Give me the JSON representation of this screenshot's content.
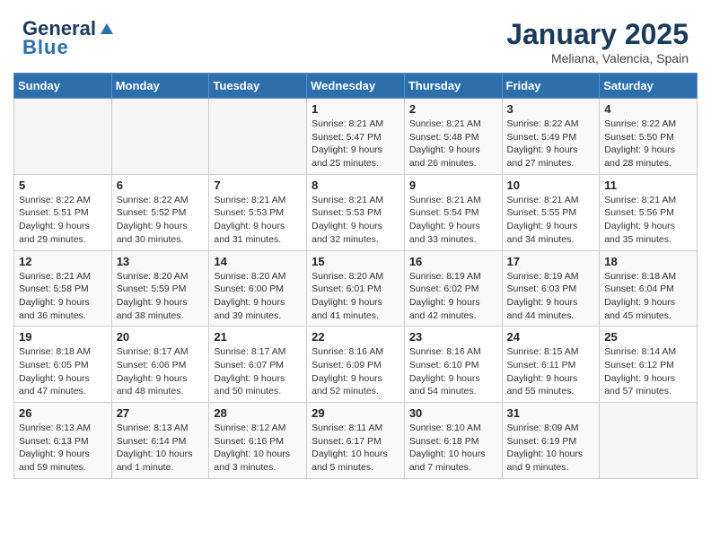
{
  "header": {
    "logo_line1": "General",
    "logo_line2": "Blue",
    "month": "January 2025",
    "location": "Meliana, Valencia, Spain"
  },
  "weekdays": [
    "Sunday",
    "Monday",
    "Tuesday",
    "Wednesday",
    "Thursday",
    "Friday",
    "Saturday"
  ],
  "weeks": [
    [
      {
        "day": "",
        "info": ""
      },
      {
        "day": "",
        "info": ""
      },
      {
        "day": "",
        "info": ""
      },
      {
        "day": "1",
        "info": "Sunrise: 8:21 AM\nSunset: 5:47 PM\nDaylight: 9 hours and 25 minutes."
      },
      {
        "day": "2",
        "info": "Sunrise: 8:21 AM\nSunset: 5:48 PM\nDaylight: 9 hours and 26 minutes."
      },
      {
        "day": "3",
        "info": "Sunrise: 8:22 AM\nSunset: 5:49 PM\nDaylight: 9 hours and 27 minutes."
      },
      {
        "day": "4",
        "info": "Sunrise: 8:22 AM\nSunset: 5:50 PM\nDaylight: 9 hours and 28 minutes."
      }
    ],
    [
      {
        "day": "5",
        "info": "Sunrise: 8:22 AM\nSunset: 5:51 PM\nDaylight: 9 hours and 29 minutes."
      },
      {
        "day": "6",
        "info": "Sunrise: 8:22 AM\nSunset: 5:52 PM\nDaylight: 9 hours and 30 minutes."
      },
      {
        "day": "7",
        "info": "Sunrise: 8:21 AM\nSunset: 5:53 PM\nDaylight: 9 hours and 31 minutes."
      },
      {
        "day": "8",
        "info": "Sunrise: 8:21 AM\nSunset: 5:53 PM\nDaylight: 9 hours and 32 minutes."
      },
      {
        "day": "9",
        "info": "Sunrise: 8:21 AM\nSunset: 5:54 PM\nDaylight: 9 hours and 33 minutes."
      },
      {
        "day": "10",
        "info": "Sunrise: 8:21 AM\nSunset: 5:55 PM\nDaylight: 9 hours and 34 minutes."
      },
      {
        "day": "11",
        "info": "Sunrise: 8:21 AM\nSunset: 5:56 PM\nDaylight: 9 hours and 35 minutes."
      }
    ],
    [
      {
        "day": "12",
        "info": "Sunrise: 8:21 AM\nSunset: 5:58 PM\nDaylight: 9 hours and 36 minutes."
      },
      {
        "day": "13",
        "info": "Sunrise: 8:20 AM\nSunset: 5:59 PM\nDaylight: 9 hours and 38 minutes."
      },
      {
        "day": "14",
        "info": "Sunrise: 8:20 AM\nSunset: 6:00 PM\nDaylight: 9 hours and 39 minutes."
      },
      {
        "day": "15",
        "info": "Sunrise: 8:20 AM\nSunset: 6:01 PM\nDaylight: 9 hours and 41 minutes."
      },
      {
        "day": "16",
        "info": "Sunrise: 8:19 AM\nSunset: 6:02 PM\nDaylight: 9 hours and 42 minutes."
      },
      {
        "day": "17",
        "info": "Sunrise: 8:19 AM\nSunset: 6:03 PM\nDaylight: 9 hours and 44 minutes."
      },
      {
        "day": "18",
        "info": "Sunrise: 8:18 AM\nSunset: 6:04 PM\nDaylight: 9 hours and 45 minutes."
      }
    ],
    [
      {
        "day": "19",
        "info": "Sunrise: 8:18 AM\nSunset: 6:05 PM\nDaylight: 9 hours and 47 minutes."
      },
      {
        "day": "20",
        "info": "Sunrise: 8:17 AM\nSunset: 6:06 PM\nDaylight: 9 hours and 48 minutes."
      },
      {
        "day": "21",
        "info": "Sunrise: 8:17 AM\nSunset: 6:07 PM\nDaylight: 9 hours and 50 minutes."
      },
      {
        "day": "22",
        "info": "Sunrise: 8:16 AM\nSunset: 6:09 PM\nDaylight: 9 hours and 52 minutes."
      },
      {
        "day": "23",
        "info": "Sunrise: 8:16 AM\nSunset: 6:10 PM\nDaylight: 9 hours and 54 minutes."
      },
      {
        "day": "24",
        "info": "Sunrise: 8:15 AM\nSunset: 6:11 PM\nDaylight: 9 hours and 55 minutes."
      },
      {
        "day": "25",
        "info": "Sunrise: 8:14 AM\nSunset: 6:12 PM\nDaylight: 9 hours and 57 minutes."
      }
    ],
    [
      {
        "day": "26",
        "info": "Sunrise: 8:13 AM\nSunset: 6:13 PM\nDaylight: 9 hours and 59 minutes."
      },
      {
        "day": "27",
        "info": "Sunrise: 8:13 AM\nSunset: 6:14 PM\nDaylight: 10 hours and 1 minute."
      },
      {
        "day": "28",
        "info": "Sunrise: 8:12 AM\nSunset: 6:16 PM\nDaylight: 10 hours and 3 minutes."
      },
      {
        "day": "29",
        "info": "Sunrise: 8:11 AM\nSunset: 6:17 PM\nDaylight: 10 hours and 5 minutes."
      },
      {
        "day": "30",
        "info": "Sunrise: 8:10 AM\nSunset: 6:18 PM\nDaylight: 10 hours and 7 minutes."
      },
      {
        "day": "31",
        "info": "Sunrise: 8:09 AM\nSunset: 6:19 PM\nDaylight: 10 hours and 9 minutes."
      },
      {
        "day": "",
        "info": ""
      }
    ]
  ]
}
